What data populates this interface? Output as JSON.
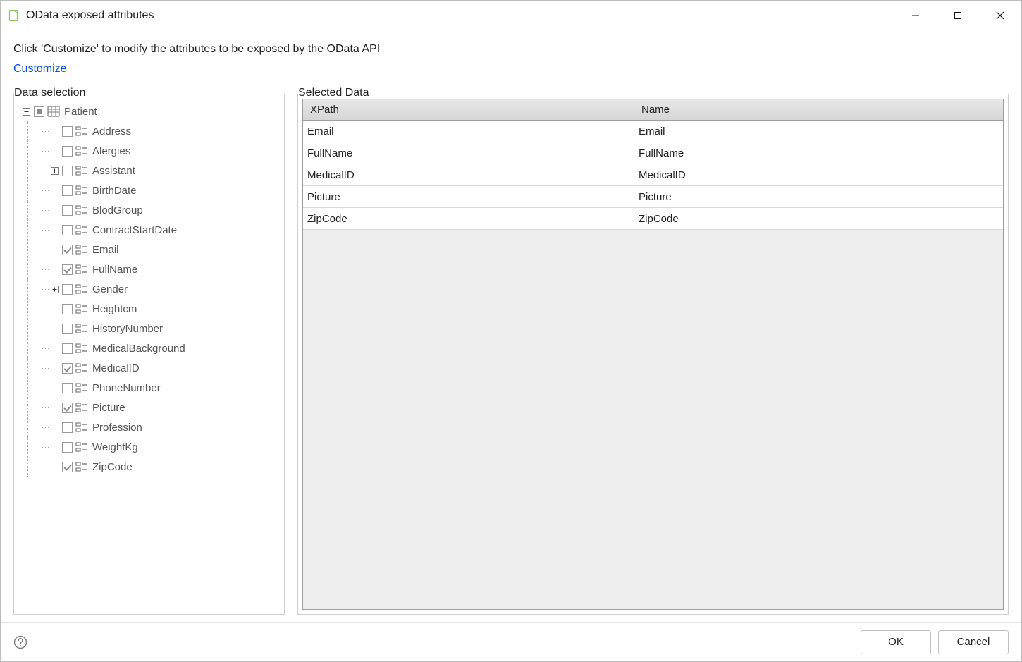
{
  "window": {
    "title": "OData exposed attributes"
  },
  "header": {
    "instruction": "Click 'Customize' to modify the attributes to be exposed by the OData API",
    "customize_link": "Customize"
  },
  "panel_tree": {
    "legend": "Data selection"
  },
  "panel_table": {
    "legend": "Selected Data"
  },
  "tree": {
    "root": {
      "label": "Patient",
      "checked": "mixed",
      "expanded": true
    },
    "children": [
      {
        "label": "Address",
        "checked": false,
        "expandable": false
      },
      {
        "label": "Alergies",
        "checked": false,
        "expandable": false
      },
      {
        "label": "Assistant",
        "checked": false,
        "expandable": true,
        "expanded": false
      },
      {
        "label": "BirthDate",
        "checked": false,
        "expandable": false
      },
      {
        "label": "BlodGroup",
        "checked": false,
        "expandable": false
      },
      {
        "label": "ContractStartDate",
        "checked": false,
        "expandable": false
      },
      {
        "label": "Email",
        "checked": true,
        "expandable": false
      },
      {
        "label": "FullName",
        "checked": true,
        "expandable": false
      },
      {
        "label": "Gender",
        "checked": false,
        "expandable": true,
        "expanded": false
      },
      {
        "label": "Heightcm",
        "checked": false,
        "expandable": false
      },
      {
        "label": "HistoryNumber",
        "checked": false,
        "expandable": false
      },
      {
        "label": "MedicalBackground",
        "checked": false,
        "expandable": false
      },
      {
        "label": "MedicalID",
        "checked": true,
        "expandable": false
      },
      {
        "label": "PhoneNumber",
        "checked": false,
        "expandable": false
      },
      {
        "label": "Picture",
        "checked": true,
        "expandable": false
      },
      {
        "label": "Profession",
        "checked": false,
        "expandable": false
      },
      {
        "label": "WeightKg",
        "checked": false,
        "expandable": false
      },
      {
        "label": "ZipCode",
        "checked": true,
        "expandable": false
      }
    ]
  },
  "table": {
    "columns": {
      "xpath": "XPath",
      "name": "Name"
    },
    "rows": [
      {
        "xpath": "Email",
        "name": "Email"
      },
      {
        "xpath": "FullName",
        "name": "FullName"
      },
      {
        "xpath": "MedicalID",
        "name": "MedicalID"
      },
      {
        "xpath": "Picture",
        "name": "Picture"
      },
      {
        "xpath": "ZipCode",
        "name": "ZipCode"
      }
    ]
  },
  "footer": {
    "ok": "OK",
    "cancel": "Cancel"
  }
}
